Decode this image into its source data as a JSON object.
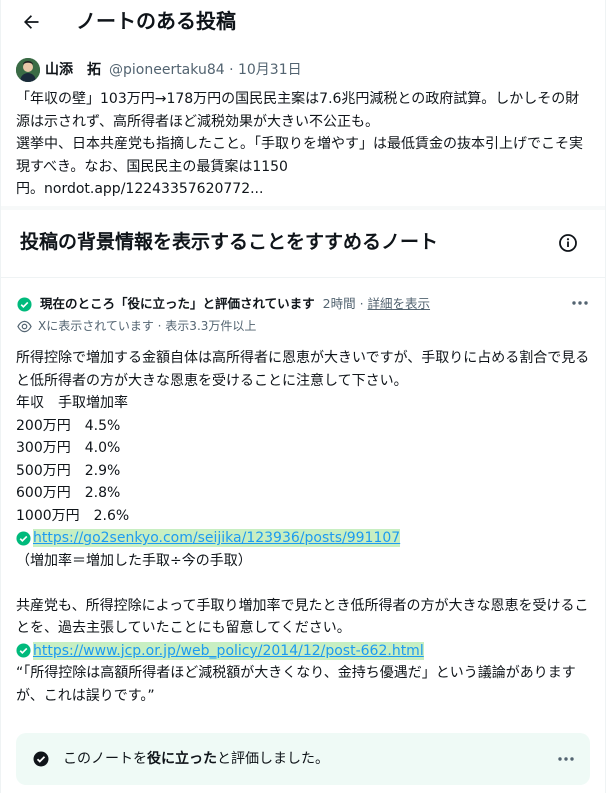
{
  "header": {
    "title": "ノートのある投稿"
  },
  "post": {
    "author_name": "山添　拓",
    "meta": "@pioneertaku84 · 10月31日",
    "text": "「年収の壁」103万円→178万円の国民民主案は7.6兆円減税との政府試算。しかしその財源は示されず、高所得者ほど減税効果が大きい不公正も。\n選挙中、日本共産党も指摘したこと。「手取りを増やす」は最低賃金の抜本引上げでこそ実現すべき。なお、国民民主の最賃案は1150\n円。nordot.app/12243357620772..."
  },
  "section": {
    "title": "投稿の背景情報を表示することをすすめるノート"
  },
  "note": {
    "status_label": "現在のところ「役に立った」と評価されています",
    "time": "2時間 · ",
    "details_link": "詳細を表示",
    "views": "Xに表示されています · 表示3.3万件以上",
    "para1": "所得控除で増加する金額自体は高所得者に恩恵が大きいですが、手取りに占める割合で見ると低所得者の方が大きな恩恵を受けることに注意して下さい。\n年収　手取増加率\n200万円　4.5%\n300万円　4.0%\n500万円　2.9%\n600万円　2.8%\n1000万円　2.6%",
    "link1": "https://go2senkyo.com/seijika/123936/posts/991107",
    "para2": "（増加率＝増加した手取÷今の手取）\n\n共産党も、所得控除によって手取り増加率で見たとき低所得者の方が大きな恩恵を受けることを、過去主張していたことにも留意してください。",
    "link2": "https://www.jcp.or.jp/web_policy/2014/12/post-662.html",
    "para3": "“「所得控除は高額所得者ほど減税額が大きくなり、金持ち優遇だ」という議論がありますが、これは誤りです。”"
  },
  "rated": {
    "prefix": "このノートを",
    "bold": "役に立った",
    "suffix": "と評価しました。"
  },
  "colors": {
    "accent_green": "#00ba7c",
    "link_blue": "#1d9bf0",
    "link_highlight": "#c8efc2",
    "rated_bg": "#effaf6"
  }
}
